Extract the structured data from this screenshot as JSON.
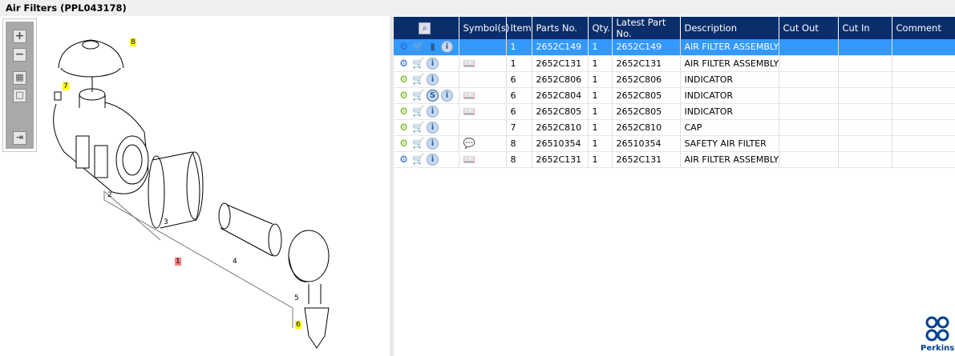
{
  "window": {
    "title": "Air Filters (PPL043178)"
  },
  "toolbar": {
    "zoom_in": "+",
    "zoom_out": "−",
    "fit": "▦",
    "actual": "□",
    "export": "⇥"
  },
  "callouts": [
    "8",
    "7",
    "2",
    "3",
    "1",
    "4",
    "5",
    "6"
  ],
  "table": {
    "columns": [
      "",
      "Symbol(s)",
      "Item",
      "Parts No.",
      "Qty.",
      "Latest Part No.",
      "Description",
      "Cut Out",
      "Cut In",
      "Comment"
    ],
    "rows": [
      {
        "icons": [
          "gears-icon",
          "cart-icon",
          "document-icon",
          "info-icon"
        ],
        "symbol": "",
        "item": "1",
        "part": "2652C149",
        "qty": "1",
        "latest": "2652C149",
        "desc": "AIR FILTER ASSEMBLY",
        "selected": true
      },
      {
        "icons": [
          "gears-icon",
          "cart-icon",
          "info-icon"
        ],
        "symbol": "book-icon",
        "item": "1",
        "part": "2652C131",
        "qty": "1",
        "latest": "2652C131",
        "desc": "AIR FILTER ASSEMBLY"
      },
      {
        "icons": [
          "gear-icon",
          "cart-icon",
          "info-icon"
        ],
        "symbol": "",
        "item": "6",
        "part": "2652C806",
        "qty": "1",
        "latest": "2652C806",
        "desc": "INDICATOR"
      },
      {
        "icons": [
          "gear-icon",
          "cart-icon",
          "s-icon",
          "info-icon"
        ],
        "symbol": "book-icon",
        "item": "6",
        "part": "2652C804",
        "qty": "1",
        "latest": "2652C805",
        "desc": "INDICATOR"
      },
      {
        "icons": [
          "gear-icon",
          "cart-icon",
          "info-icon"
        ],
        "symbol": "book-icon",
        "item": "6",
        "part": "2652C805",
        "qty": "1",
        "latest": "2652C805",
        "desc": "INDICATOR"
      },
      {
        "icons": [
          "gear-icon",
          "cart-icon",
          "info-icon"
        ],
        "symbol": "",
        "item": "7",
        "part": "2652C810",
        "qty": "1",
        "latest": "2652C810",
        "desc": "CAP"
      },
      {
        "icons": [
          "gear-icon",
          "cart-icon",
          "info-icon"
        ],
        "symbol": "comment-icon",
        "item": "8",
        "part": "26510354",
        "qty": "1",
        "latest": "26510354",
        "desc": "SAFETY AIR FILTER"
      },
      {
        "icons": [
          "gears-icon",
          "cart-icon",
          "info-icon"
        ],
        "symbol": "book-icon",
        "item": "8",
        "part": "2652C131",
        "qty": "1",
        "latest": "2652C131",
        "desc": "AIR FILTER ASSEMBLY"
      }
    ]
  },
  "logo": {
    "text": "Perkins"
  },
  "colors": {
    "header": "#0a2d6b",
    "selected": "#3399ff",
    "callout": "#ffff00",
    "callout_main": "#ff8080"
  }
}
